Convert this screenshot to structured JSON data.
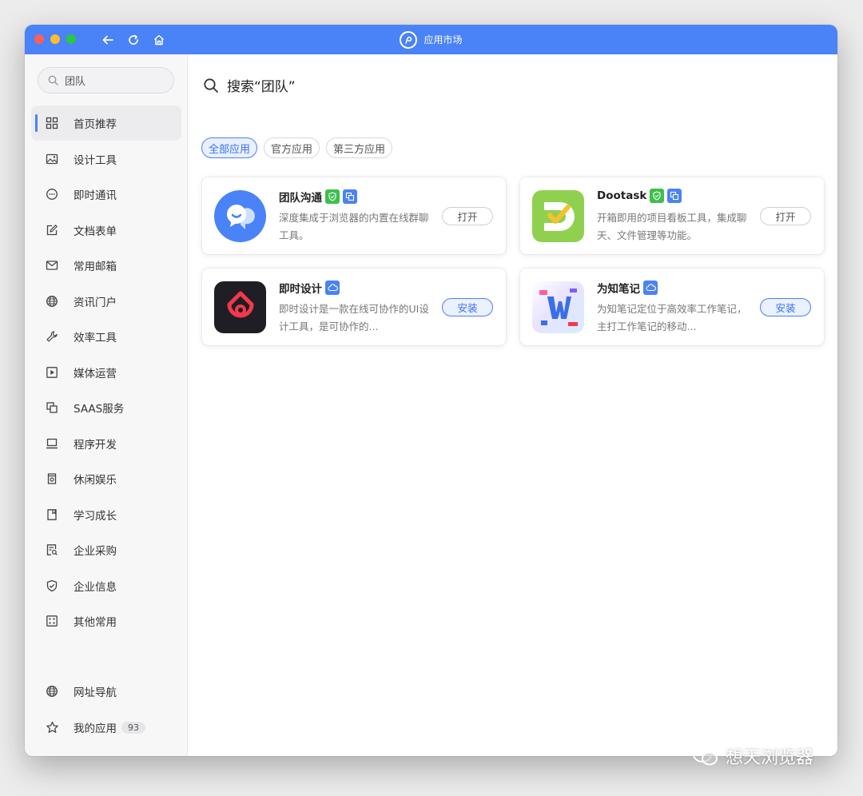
{
  "titlebar": {
    "title": "应用市场",
    "buttons": [
      "back-icon",
      "refresh-icon",
      "home-icon"
    ]
  },
  "sidebar": {
    "search": {
      "value": "团队",
      "placeholder": "团队"
    },
    "items": [
      {
        "label": "首页推荐",
        "icon": "grid-icon",
        "active": true
      },
      {
        "label": "设计工具",
        "icon": "image-icon"
      },
      {
        "label": "即时通讯",
        "icon": "chat-bubble-icon"
      },
      {
        "label": "文档表单",
        "icon": "edit-icon"
      },
      {
        "label": "常用邮箱",
        "icon": "mail-icon"
      },
      {
        "label": "资讯门户",
        "icon": "globe-icon"
      },
      {
        "label": "效率工具",
        "icon": "wrench-icon"
      },
      {
        "label": "媒体运营",
        "icon": "play-icon"
      },
      {
        "label": "SAAS服务",
        "icon": "copy-icon"
      },
      {
        "label": "程序开发",
        "icon": "laptop-icon"
      },
      {
        "label": "休闲娱乐",
        "icon": "cup-icon"
      },
      {
        "label": "学习成长",
        "icon": "book-icon"
      },
      {
        "label": "企业采购",
        "icon": "receipt-search-icon"
      },
      {
        "label": "企业信息",
        "icon": "shield-check-icon"
      },
      {
        "label": "其他常用",
        "icon": "apps-icon"
      }
    ],
    "bottom_items": [
      {
        "label": "网址导航",
        "icon": "globe-icon"
      },
      {
        "label": "我的应用",
        "icon": "star-icon",
        "count": "93"
      }
    ]
  },
  "main": {
    "search_heading": "搜索“团队”",
    "filters": [
      {
        "label": "全部应用",
        "active": true
      },
      {
        "label": "官方应用"
      },
      {
        "label": "第三方应用"
      }
    ],
    "apps": [
      {
        "name": "团队沟通",
        "desc": "深度集成于浏览器的内置在线群聊工具。",
        "action": "打开",
        "badges": [
          "shield-badge-icon",
          "copy-badge-icon"
        ],
        "icon_color": "#4a82f7"
      },
      {
        "name": "Dootask",
        "desc": "开箱即用的项目看板工具，集成聊天、文件管理等功能。",
        "action": "打开",
        "badges": [
          "shield-badge-icon",
          "copy-badge-icon"
        ],
        "icon_color": "#8fd14f"
      },
      {
        "name": "即时设计",
        "desc": "即时设计是一款在线可协作的UI设计工具，是可协作的...",
        "action": "安装",
        "badges": [
          "cloud-badge-icon"
        ],
        "icon_color": "#1e1e24"
      },
      {
        "name": "为知笔记",
        "desc": "为知笔记定位于高效率工作笔记，主打工作笔记的移动...",
        "action": "安装",
        "badges": [
          "cloud-badge-icon"
        ],
        "icon_color": "#3a6fe8"
      }
    ]
  },
  "watermark": {
    "text": "想天浏览器",
    "icon": "wechat-icon"
  }
}
